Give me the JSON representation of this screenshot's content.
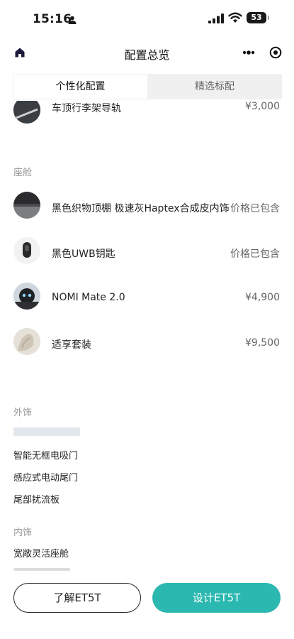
{
  "status_bar": {
    "time": "15:16",
    "battery": "53"
  },
  "nav": {
    "title": "配置总览"
  },
  "tabs": [
    {
      "label": "个性化配置"
    },
    {
      "label": "精选标配"
    }
  ],
  "partial_row": {
    "name": "车顶行李架导轨",
    "price": "¥3,000"
  },
  "cabin": {
    "label": "座舱",
    "items": [
      {
        "name": "黑色织物顶棚 极速灰Haptex合成皮内饰",
        "price": "价格已包含"
      },
      {
        "name": "黑色UWB钥匙",
        "price": "价格已包含"
      },
      {
        "name": "NOMI Mate 2.0",
        "price": "¥4,900"
      },
      {
        "name": "适享套装",
        "price": "¥9,500"
      }
    ]
  },
  "exterior": {
    "label": "外饰",
    "items": [
      "智能无框电吸门",
      "感应式电动尾门",
      "尾部扰流板"
    ]
  },
  "interior": {
    "label": "内饰",
    "items": [
      "宽敞灵活座舱"
    ]
  },
  "buttons": {
    "learn": "了解ET5T",
    "design": "设计ET5T"
  },
  "colors": {
    "accent": "#2bb8b0"
  }
}
